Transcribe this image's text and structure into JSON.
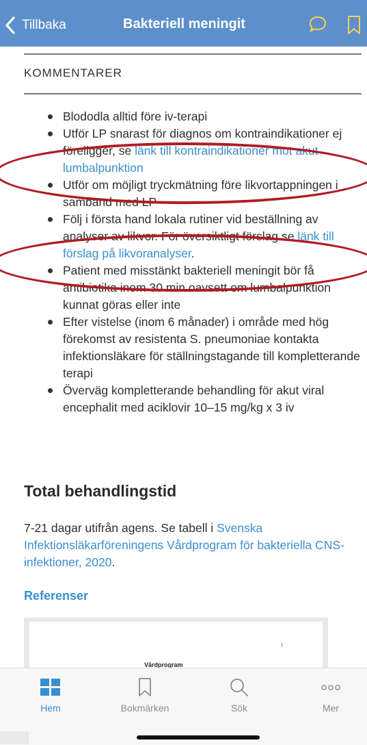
{
  "header": {
    "back_label": "Tillbaka",
    "title": "Bakteriell meningit",
    "background": "#5d8fcb"
  },
  "comments": {
    "section_label": "KOMMENTARER",
    "bullets": [
      {
        "text": "Blododla alltid före iv-terapi"
      },
      {
        "text": "Utför LP snarast för diagnos om kontraindikationer ej föreligger, se ",
        "link": "länk till kontraindikationer mot akut lumbalpunktion"
      },
      {
        "text": "Utför om möjligt tryckmätning före likvortappningen i samband med LP"
      },
      {
        "text": "Följ i första hand lokala rutiner vid beställning av analyser av likvor. För översiktligt förslag se ",
        "link": "länk till förslag på likvoranalyser",
        "after": "."
      },
      {
        "text": "Patient med misstänkt bakteriell meningit bör få antibiotika inom 30 min oavsett om lumbalpunktion kunnat göras eller inte"
      },
      {
        "text": "Efter vistelse (inom 6 månader) i område med hög förekomst av resistenta S. pneumoniae kontakta infektionsläkare för ställningstagande till kompletterande terapi"
      },
      {
        "text": "Överväg kompletterande behandling för akut viral encephalit med aciklovir 10–15 mg/kg x 3 iv"
      }
    ]
  },
  "treatment": {
    "heading": "Total behandlingstid",
    "text": "7-21 dagar utifrån agens. Se tabell i ",
    "link": "Svenska Infektionsläkarföreningens Vårdprogram för bakteriella CNS-infektioner, 2020",
    "after": "."
  },
  "references": {
    "label": "Referenser",
    "preview_page_number": "1",
    "preview_title": "Vårdprogram"
  },
  "tabbar": {
    "items": [
      {
        "label": "Hem",
        "icon": "grid-icon",
        "active": true
      },
      {
        "label": "Bokmärken",
        "icon": "bookmark-icon",
        "active": false
      },
      {
        "label": "Sök",
        "icon": "search-icon",
        "active": false
      },
      {
        "label": "Mer",
        "icon": "more-icon",
        "active": false
      }
    ]
  },
  "colors": {
    "accent": "#3a8ed0",
    "annotation": "#b01c22"
  }
}
